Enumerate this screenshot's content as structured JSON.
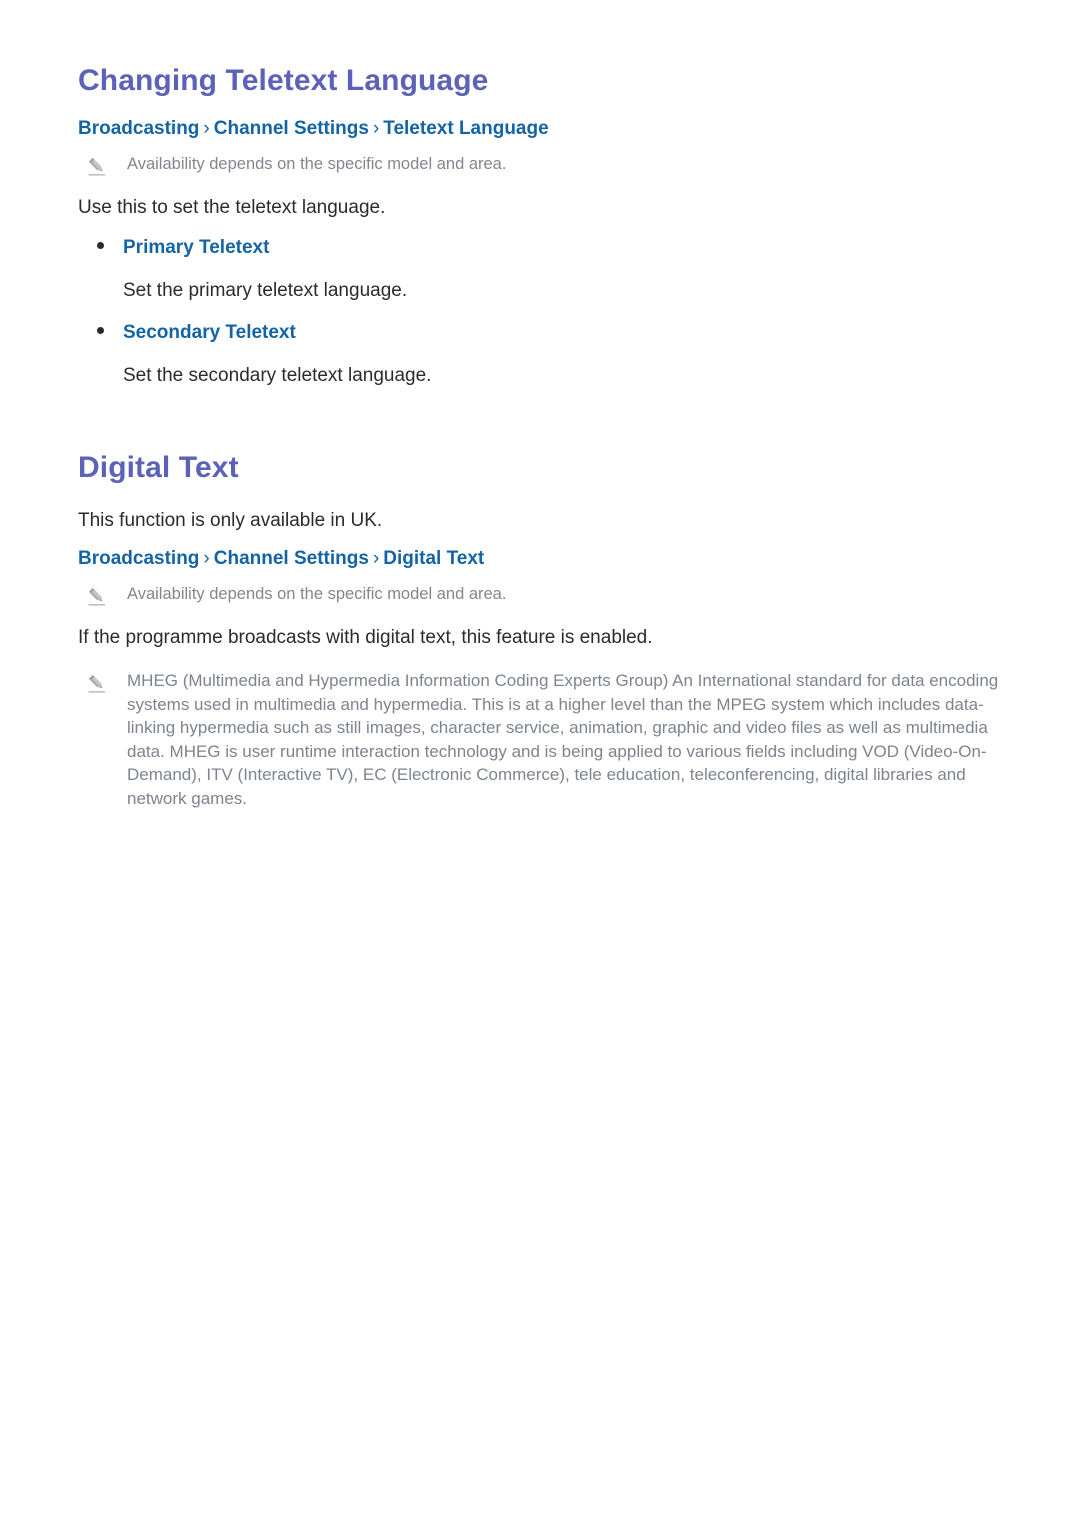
{
  "sections": [
    {
      "title": "Changing Teletext Language",
      "breadcrumb": {
        "items": [
          "Broadcasting",
          "Channel Settings",
          "Teletext Language"
        ],
        "separator": "›"
      },
      "note": "Availability depends on the specific model and area.",
      "intro": "Use this to set the teletext language.",
      "bullets": [
        {
          "label": "Primary Teletext",
          "description": "Set the primary teletext language."
        },
        {
          "label": "Secondary Teletext",
          "description": "Set the secondary teletext language."
        }
      ]
    },
    {
      "title": "Digital Text",
      "lead": "This function is only available in UK.",
      "breadcrumb": {
        "items": [
          "Broadcasting",
          "Channel Settings",
          "Digital Text"
        ],
        "separator": "›"
      },
      "note": "Availability depends on the specific model and area.",
      "body": "If the programme broadcasts with digital text, this feature is enabled.",
      "long_note": "MHEG (Multimedia and Hypermedia Information Coding Experts Group) An International standard for data encoding systems used in multimedia and hypermedia. This is at a higher level than the MPEG system which includes data-linking hypermedia such as still images, character service, animation, graphic and video files as well as multimedia data. MHEG is user runtime interaction technology and is being applied to various fields including VOD (Video-On-Demand), ITV (Interactive TV), EC (Electronic Commerce), tele education, teleconferencing, digital libraries and network games."
    }
  ],
  "icons": {
    "note": "pencil-icon"
  },
  "colors": {
    "heading": "#5b62b8",
    "link": "#1464a5",
    "body": "#2b2b2b",
    "note": "#82868f",
    "background": "#ffffff"
  }
}
